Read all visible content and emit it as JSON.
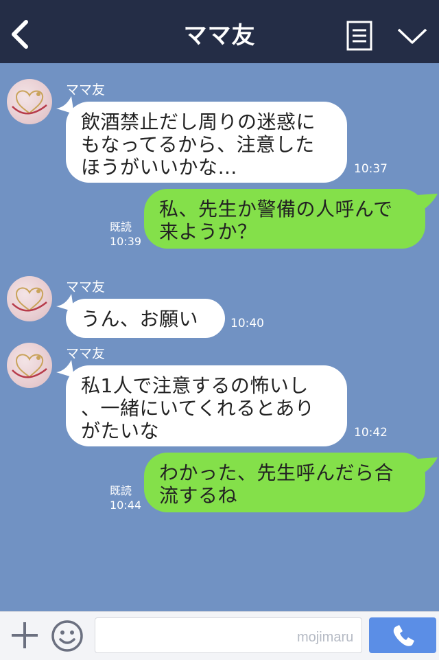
{
  "header": {
    "title": "ママ友",
    "back_icon": "chevron-left-icon",
    "menu_icon": "menu-list-icon",
    "collapse_icon": "chevron-down-icon"
  },
  "messages": [
    {
      "side": "in",
      "sender": "ママ友",
      "lines": [
        "飲酒禁止だし周りの迷惑に",
        "もなってるから、注意した",
        "ほうがいいかな…"
      ],
      "time": "10:37"
    },
    {
      "side": "out",
      "lines": [
        "私、先生か警備の人呼んで",
        "来ようか？"
      ],
      "read": "既読",
      "time": "10:39"
    },
    {
      "side": "in",
      "sender": "ママ友",
      "lines": [
        "うん、お願い"
      ],
      "time": "10:40"
    },
    {
      "side": "in",
      "sender": "ママ友",
      "lines": [
        "私1人で注意するの怖いし",
        "、一緒にいてくれるとあり",
        "がたいな"
      ],
      "time": "10:42"
    },
    {
      "side": "out",
      "lines": [
        "わかった、先生呼んだら合",
        "流するね"
      ],
      "read": "既読",
      "time": "10:44"
    }
  ],
  "footer": {
    "input_value": "",
    "watermark": "mojimaru",
    "plus_icon": "plus-icon",
    "emoji_icon": "smiley-icon",
    "call_icon": "phone-icon"
  },
  "colors": {
    "background": "#7192c3",
    "header": "#242d46",
    "outgoing_bubble": "#84e04a",
    "incoming_bubble": "#ffffff",
    "call_button": "#5b8ee6"
  }
}
